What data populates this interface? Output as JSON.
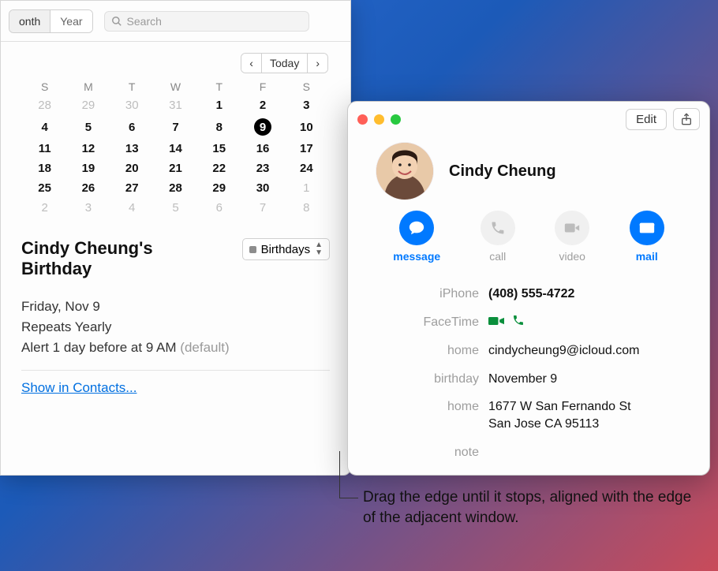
{
  "calendar": {
    "view_segments": [
      "onth",
      "Year"
    ],
    "search_placeholder": "Search",
    "nav": {
      "prev": "‹",
      "today": "Today",
      "next": "›"
    },
    "weekdays": [
      "S",
      "M",
      "T",
      "W",
      "T",
      "F",
      "S"
    ],
    "grid": [
      [
        {
          "d": "28",
          "o": true
        },
        {
          "d": "29",
          "o": true
        },
        {
          "d": "30",
          "o": true
        },
        {
          "d": "31",
          "o": true
        },
        {
          "d": "1"
        },
        {
          "d": "2"
        },
        {
          "d": "3"
        }
      ],
      [
        {
          "d": "4"
        },
        {
          "d": "5"
        },
        {
          "d": "6"
        },
        {
          "d": "7"
        },
        {
          "d": "8"
        },
        {
          "d": "9",
          "sel": true
        },
        {
          "d": "10"
        }
      ],
      [
        {
          "d": "11"
        },
        {
          "d": "12"
        },
        {
          "d": "13"
        },
        {
          "d": "14"
        },
        {
          "d": "15"
        },
        {
          "d": "16"
        },
        {
          "d": "17"
        }
      ],
      [
        {
          "d": "18"
        },
        {
          "d": "19"
        },
        {
          "d": "20"
        },
        {
          "d": "21"
        },
        {
          "d": "22"
        },
        {
          "d": "23"
        },
        {
          "d": "24"
        }
      ],
      [
        {
          "d": "25"
        },
        {
          "d": "26"
        },
        {
          "d": "27"
        },
        {
          "d": "28"
        },
        {
          "d": "29"
        },
        {
          "d": "30"
        },
        {
          "d": "1",
          "o": true
        }
      ],
      [
        {
          "d": "2",
          "o": true
        },
        {
          "d": "3",
          "o": true
        },
        {
          "d": "4",
          "o": true
        },
        {
          "d": "5",
          "o": true
        },
        {
          "d": "6",
          "o": true
        },
        {
          "d": "7",
          "o": true
        },
        {
          "d": "8",
          "o": true
        }
      ]
    ],
    "event": {
      "title": "Cindy Cheung's Birthday",
      "cal_name": "Birthdays",
      "date_line": "Friday, Nov 9",
      "repeat_line": "Repeats Yearly",
      "alert_line": "Alert 1 day before at 9 AM ",
      "alert_suffix": "(default)",
      "link": "Show in Contacts..."
    }
  },
  "contacts": {
    "edit": "Edit",
    "name": "Cindy Cheung",
    "actions": [
      {
        "key": "message",
        "label": "message",
        "on": true,
        "icon": "message"
      },
      {
        "key": "call",
        "label": "call",
        "on": false,
        "icon": "phone"
      },
      {
        "key": "video",
        "label": "video",
        "on": false,
        "icon": "video"
      },
      {
        "key": "mail",
        "label": "mail",
        "on": true,
        "icon": "mail"
      }
    ],
    "fields": [
      {
        "k": "iPhone",
        "v": "(408) 555-4722",
        "bold": true
      },
      {
        "k": "FaceTime",
        "v": "",
        "ft": true
      },
      {
        "k": "home",
        "v": "cindycheung9@icloud.com"
      },
      {
        "k": "birthday",
        "v": "November 9"
      },
      {
        "k": "home",
        "v": "1677 W San Fernando St\nSan Jose CA 95113"
      },
      {
        "k": "note",
        "v": ""
      }
    ]
  },
  "annotation": "Drag the edge until it stops, aligned with the edge of the adjacent window."
}
